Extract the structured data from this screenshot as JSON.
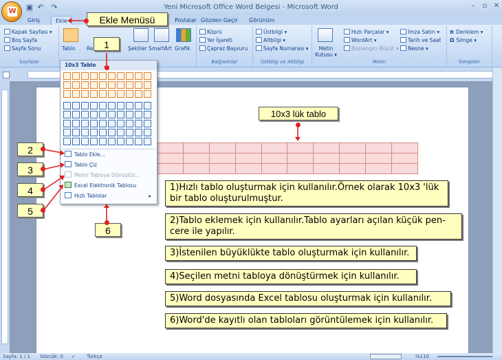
{
  "window": {
    "title": "Yeni Microsoft Office Word Belgesi - Microsoft Word",
    "minimize": "–",
    "maximize": "▫",
    "close": "✕"
  },
  "tabs": [
    "Giriş",
    "Ekle",
    "Postalar",
    "Gözden Geçir",
    "Görünüm"
  ],
  "ribbon": {
    "pages": {
      "items": [
        "Kapak Sayfası ▾",
        "Boş Sayfa",
        "Sayfa Sonu"
      ],
      "label": "Sayfalar"
    },
    "table": {
      "button": "Tablo"
    },
    "illustrations": {
      "items": [
        "Resim",
        "Şekiller",
        "SmartArt",
        "Grafik"
      ]
    },
    "links": {
      "items": [
        "Köprü",
        "Yer İşareti",
        "Çapraz Başvuru"
      ],
      "label": "Bağlantılar"
    },
    "header_footer": {
      "items": [
        "Üstbilgi ▾",
        "Altbilgi ▾",
        "Sayfa Numarası ▾"
      ],
      "label": "Üstbilgi ve Altbilgi"
    },
    "text": {
      "textbox": "Metin Kutusu ▾",
      "items": [
        "Hızlı Parçalar ▾",
        "WordArt ▾",
        "Başlangıcı Büyüt ▾"
      ],
      "items2": [
        "İmza Satırı ▾",
        "Tarih ve Saat",
        "Nesne ▾"
      ],
      "label": "Metin"
    },
    "symbols": {
      "items": [
        "Denklem ▾",
        "Simge ▾"
      ],
      "label": "Simgeler"
    }
  },
  "table_menu": {
    "header": "10x3 Tablo",
    "items": [
      {
        "label": "Tablo Ekle...",
        "disabled": false
      },
      {
        "label": "Tablo Çiz",
        "disabled": false
      },
      {
        "label": "Metni Tabloya Dönüştür...",
        "disabled": true
      },
      {
        "label": "Excel Elektronik Tablosu",
        "disabled": false
      },
      {
        "label": "Hızlı Tablolar",
        "disabled": false
      }
    ],
    "submenu_arrow": "▸"
  },
  "grid": {
    "columns": 10,
    "rows": 8,
    "selected_columns": 10,
    "selected_rows": 3
  },
  "callouts": {
    "menu_title": "Ekle Menüsü",
    "table_title": "10x3 lük tablo",
    "numbers": [
      "1",
      "2",
      "3",
      "4",
      "5",
      "6"
    ],
    "descriptions": [
      "1)Hızlı tablo oluşturmak için kullanılır.Örnek olarak 10x3 'lük bir tablo oluşturulmuştur.",
      "2)Tablo eklemek için kullanılır.Tablo ayarları açılan küçük pen-cere ile yapılır.",
      "3)İstenilen büyüklükte tablo oluşturmak için kullanılır.",
      "4)Seçilen metni tabloya dönüştürmek için kullanılır.",
      "5)Word dosyasında Excel tablosu oluşturmak için kullanılır.",
      "6)Word'de kayıtlı olan tabloları görüntülemek için kullanılır."
    ]
  },
  "status": {
    "page": "Sayfa: 1 / 1",
    "words": "Sözcük: 0",
    "language": "Türkçe",
    "zoom": "%110"
  },
  "colors": {
    "callout_bg": "#ffffc0",
    "marker": "#e02020",
    "table_fill": "#fadada"
  }
}
